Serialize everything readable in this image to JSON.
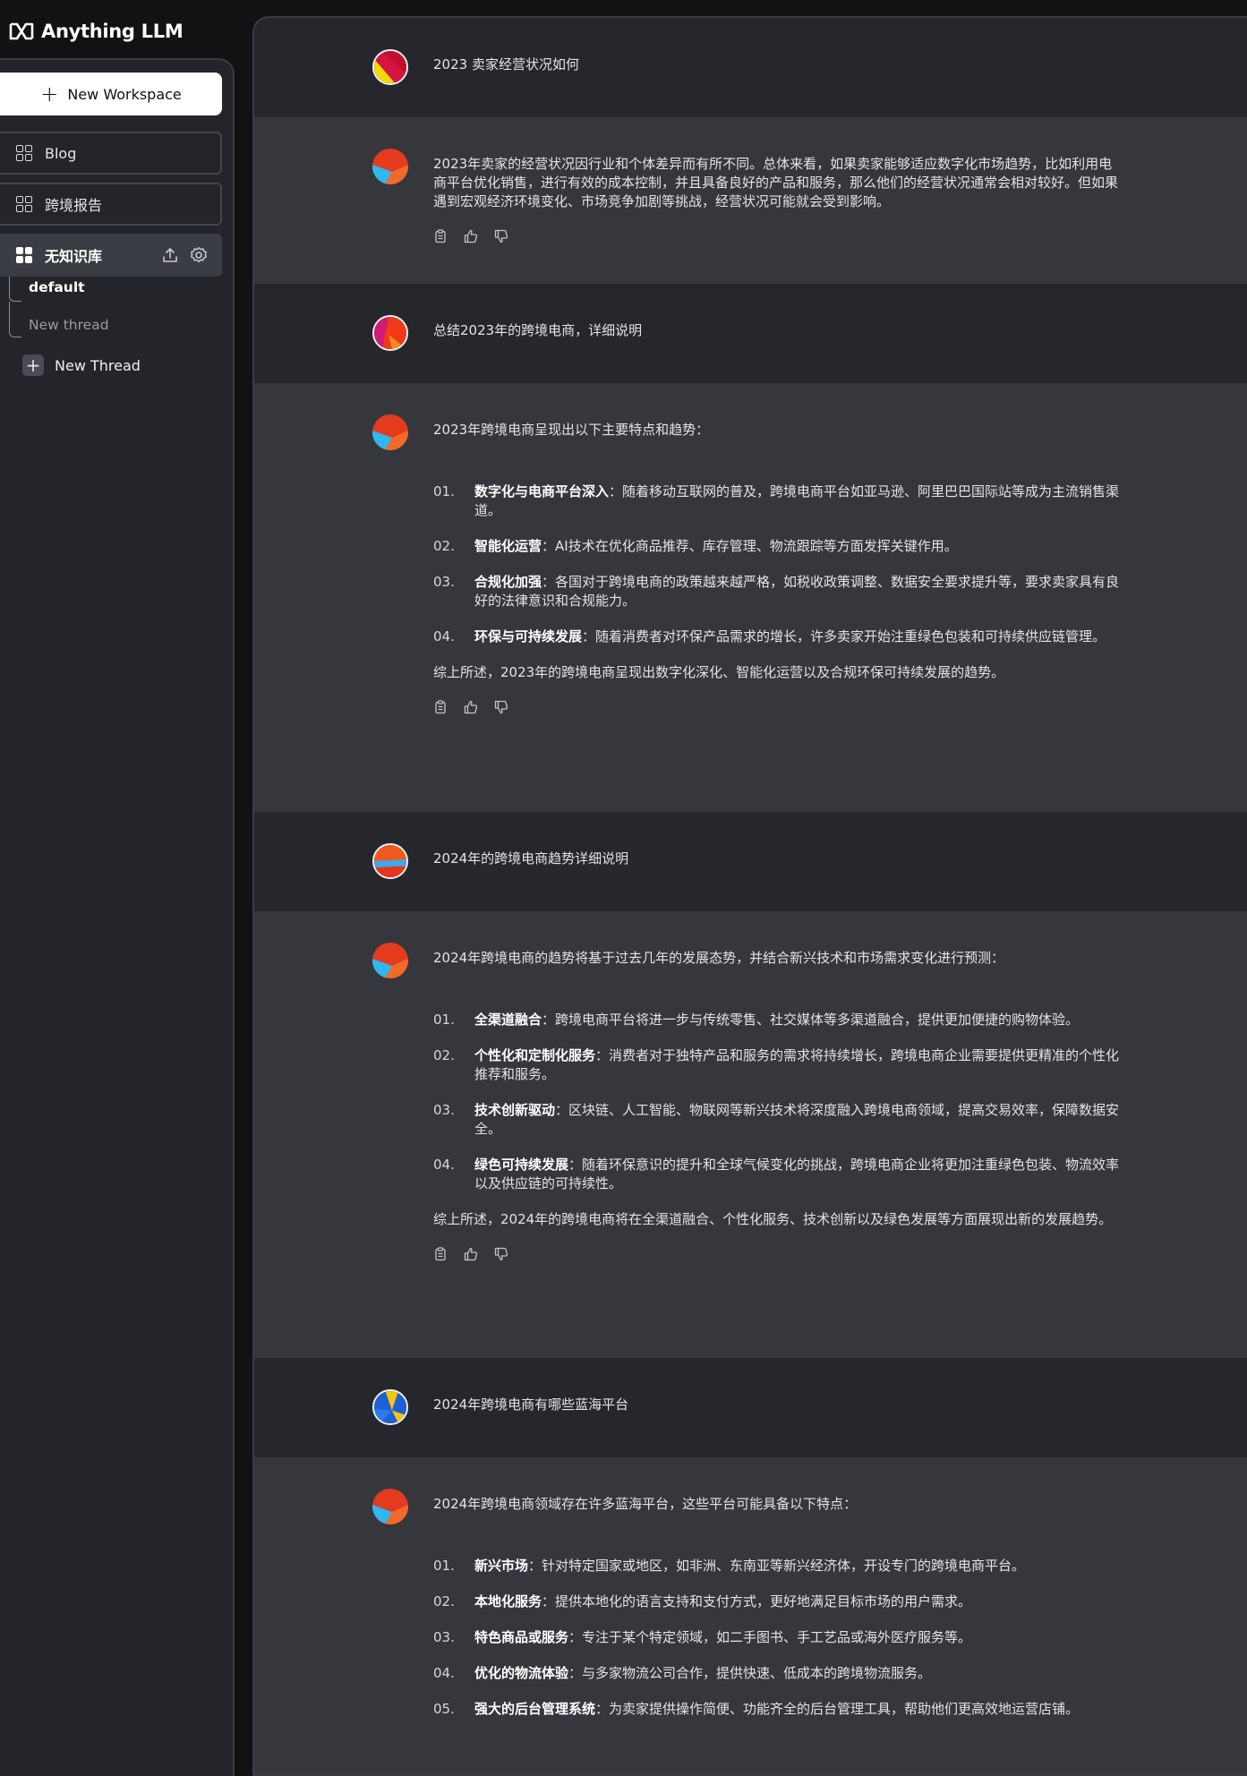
{
  "app": {
    "title": "Anything LLM"
  },
  "sidebar": {
    "new_workspace_label": "New Workspace",
    "workspaces": [
      {
        "label": "Blog"
      },
      {
        "label": "跨境报告"
      },
      {
        "label": "无知识库",
        "active": true
      }
    ],
    "threads": [
      {
        "label": "default"
      },
      {
        "label": "New thread"
      }
    ],
    "new_thread_label": "New Thread"
  },
  "chat": {
    "q1": "2023 卖家经营状况如何",
    "a1": "2023年卖家的经营状况因行业和个体差异而有所不同。总体来看，如果卖家能够适应数字化市场趋势，比如利用电商平台优化销售，进行有效的成本控制，并且具备良好的产品和服务，那么他们的经营状况通常会相对较好。但如果遇到宏观经济环境变化、市场竞争加剧等挑战，经营状况可能就会受到影响。",
    "q2": "总结2023年的跨境电商，详细说明",
    "a2": {
      "intro": "2023年跨境电商呈现出以下主要特点和趋势：",
      "points": [
        {
          "num": "01.",
          "title": "数字化与电商平台深入",
          "text": "：随着移动互联网的普及，跨境电商平台如亚马逊、阿里巴巴国际站等成为主流销售渠道。"
        },
        {
          "num": "02.",
          "title": "智能化运营",
          "text": "：AI技术在优化商品推荐、库存管理、物流跟踪等方面发挥关键作用。"
        },
        {
          "num": "03.",
          "title": "合规化加强",
          "text": "：各国对于跨境电商的政策越来越严格，如税收政策调整、数据安全要求提升等，要求卖家具有良好的法律意识和合规能力。"
        },
        {
          "num": "04.",
          "title": "环保与可持续发展",
          "text": "：随着消费者对环保产品需求的增长，许多卖家开始注重绿色包装和可持续供应链管理。"
        }
      ],
      "summary": "综上所述，2023年的跨境电商呈现出数字化深化、智能化运营以及合规环保可持续发展的趋势。"
    },
    "q3": "2024年的跨境电商趋势详细说明",
    "a3": {
      "intro": "2024年跨境电商的趋势将基于过去几年的发展态势，并结合新兴技术和市场需求变化进行预测：",
      "points": [
        {
          "num": "01.",
          "title": "全渠道融合",
          "text": "：跨境电商平台将进一步与传统零售、社交媒体等多渠道融合，提供更加便捷的购物体验。"
        },
        {
          "num": "02.",
          "title": "个性化和定制化服务",
          "text": "：消费者对于独特产品和服务的需求将持续增长，跨境电商企业需要提供更精准的个性化推荐和服务。"
        },
        {
          "num": "03.",
          "title": "技术创新驱动",
          "text": "：区块链、人工智能、物联网等新兴技术将深度融入跨境电商领域，提高交易效率，保障数据安全。"
        },
        {
          "num": "04.",
          "title": "绿色可持续发展",
          "text": "：随着环保意识的提升和全球气候变化的挑战，跨境电商企业将更加注重绿色包装、物流效率以及供应链的可持续性。"
        }
      ],
      "summary": "综上所述，2024年的跨境电商将在全渠道融合、个性化服务、技术创新以及绿色发展等方面展现出新的发展趋势。"
    },
    "q4": "2024年跨境电商有哪些蓝海平台",
    "a4": {
      "intro": "2024年跨境电商领域存在许多蓝海平台，这些平台可能具备以下特点：",
      "points": [
        {
          "num": "01.",
          "title": "新兴市场",
          "text": "：针对特定国家或地区，如非洲、东南亚等新兴经济体，开设专门的跨境电商平台。"
        },
        {
          "num": "02.",
          "title": "本地化服务",
          "text": "：提供本地化的语言支持和支付方式，更好地满足目标市场的用户需求。"
        },
        {
          "num": "03.",
          "title": "特色商品或服务",
          "text": "：专注于某个特定领域，如二手图书、手工艺品或海外医疗服务等。"
        },
        {
          "num": "04.",
          "title": "优化的物流体验",
          "text": "：与多家物流公司合作，提供快速、低成本的跨境物流服务。"
        },
        {
          "num": "05.",
          "title": "强大的后台管理系统",
          "text": "：为卖家提供操作简便、功能齐全的后台管理工具，帮助他们更高效地运营店铺。"
        }
      ]
    }
  }
}
